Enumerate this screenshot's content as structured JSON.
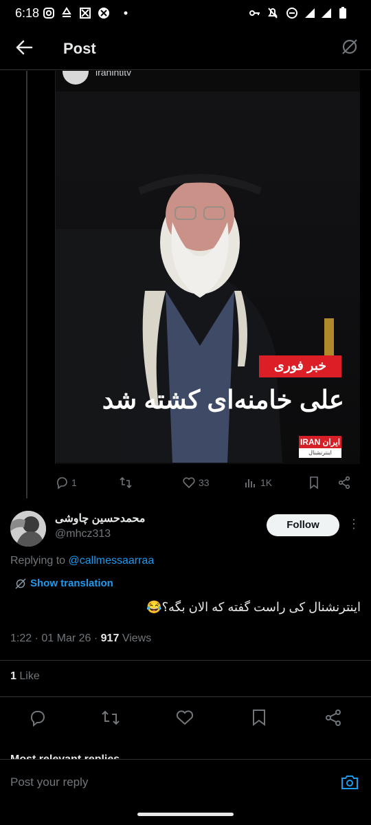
{
  "status_bar": {
    "time": "6:18",
    "icons": [
      "instagram-icon",
      "recycle-icon",
      "capcut-icon",
      "x-app-icon",
      "dot-icon",
      "key-icon",
      "bell-off-icon",
      "dnd-icon",
      "signal-icon",
      "signal-icon",
      "battery-icon"
    ]
  },
  "header": {
    "title": "Post"
  },
  "quoted_media": {
    "source_name": "iranintltv",
    "breaking_label": "خبر فوری",
    "headline": "علی خامنه‌ای کشته شد",
    "logo_top": "IRAN ایران",
    "logo_bottom": "اینترنشنال",
    "actions": {
      "replies": "1",
      "likes": "33",
      "views": "1K"
    }
  },
  "author": {
    "display_name": "محمدحسین چاوشی",
    "handle": "@mhcz313",
    "follow_label": "Follow"
  },
  "reply_to": {
    "prefix": "Replying to",
    "handle": "@callmessaarraa"
  },
  "translation": {
    "label": "Show translation"
  },
  "tweet": {
    "text": "اینترنشنال کی راست گفته که الان بگه؟😂",
    "time": "1:22",
    "date": "01 Mar 26",
    "views_count": "917",
    "views_label": "Views"
  },
  "engagement": {
    "like_count": "1",
    "like_label": "Like"
  },
  "replies_section": {
    "label": "Most relevant replies"
  },
  "composer": {
    "placeholder": "Post your reply"
  },
  "colors": {
    "accent": "#1d9bf0",
    "breaking_red": "#dc1f26",
    "background": "#000000"
  }
}
